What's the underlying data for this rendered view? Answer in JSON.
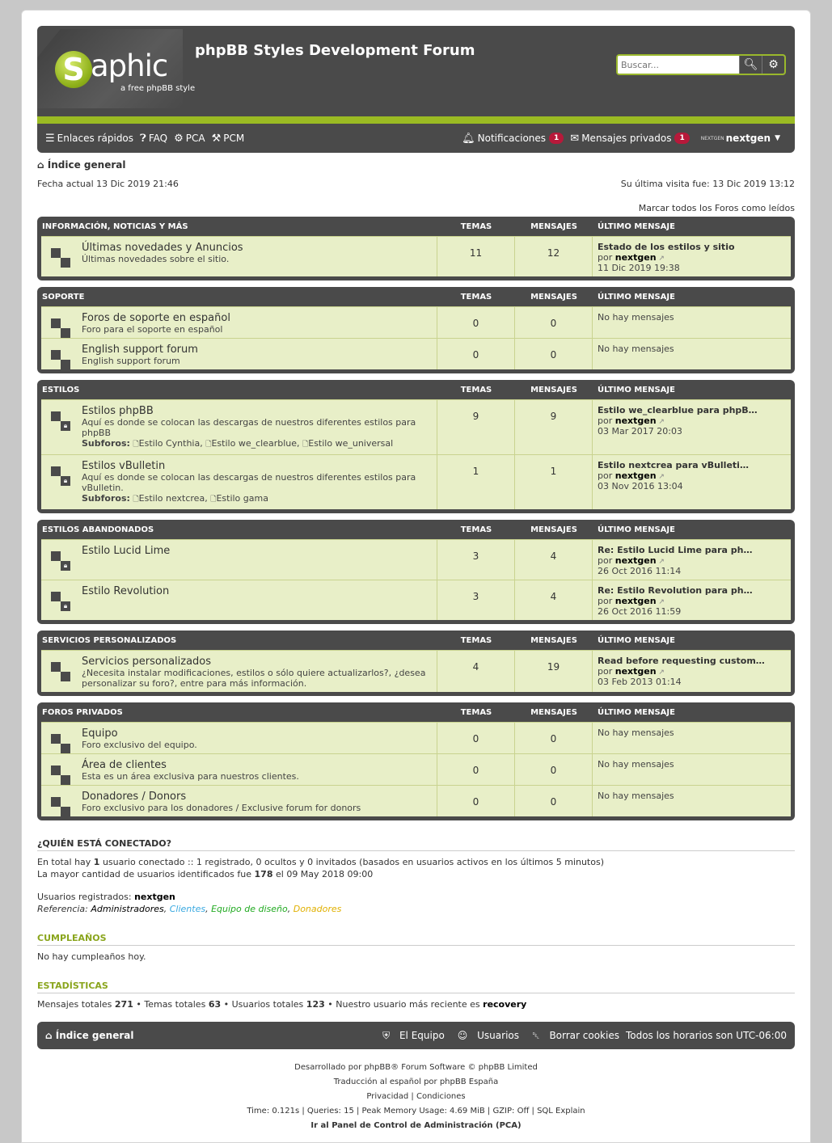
{
  "header": {
    "logo_letter": "S",
    "logo_rest": "aphic",
    "logo_sub": "a free phpBB style",
    "site_title": "phpBB Styles Development Forum",
    "search_placeholder": "Buscar..."
  },
  "nav": {
    "quick_links": "Enlaces rápidos",
    "faq": "FAQ",
    "acp": "PCA",
    "mcp": "PCM",
    "notifications": "Notificaciones",
    "notifications_count": "1",
    "private_messages": "Mensajes privados",
    "pm_count": "1",
    "avatar_text": "NEXTGEN",
    "username": "nextgen"
  },
  "breadcrumb": "Índice general",
  "current_time": "Fecha actual 13 Dic 2019 21:46",
  "last_visit": "Su última visita fue: 13 Dic 2019 13:12",
  "mark_read": "Marcar todos los Foros como leídos",
  "col_topics": "TEMAS",
  "col_posts": "MENSAJES",
  "col_last": "ÚLTIMO MENSAJE",
  "subforums_label": "Subforos:",
  "by_label": "por",
  "categories": [
    {
      "name": "INFORMACIÓN, NOTICIAS Y MÁS",
      "forums": [
        {
          "title": "Últimas novedades y Anuncios",
          "desc": "Últimas novedades sobre el sitio.",
          "topics": "11",
          "posts": "12",
          "last_title": "Estado de los estilos y sitio",
          "last_user": "nextgen",
          "last_date": "11 Dic 2019 19:38",
          "locked": false
        }
      ]
    },
    {
      "name": "SOPORTE",
      "forums": [
        {
          "title": "Foros de soporte en español",
          "desc": "Foro para el soporte en español",
          "topics": "0",
          "posts": "0",
          "no_posts": "No hay mensajes",
          "locked": false
        },
        {
          "title": "English support forum",
          "desc": "English support forum",
          "topics": "0",
          "posts": "0",
          "no_posts": "No hay mensajes",
          "locked": false
        }
      ]
    },
    {
      "name": "ESTILOS",
      "forums": [
        {
          "title": "Estilos phpBB",
          "desc": "Aquí es donde se colocan las descargas de nuestros diferentes estilos para phpBB",
          "subforums": [
            "Estilo Cynthia,",
            "Estilo we_clearblue,",
            "Estilo we_universal"
          ],
          "topics": "9",
          "posts": "9",
          "last_title": "Estilo we_clearblue para phpB…",
          "last_user": "nextgen",
          "last_date": "03 Mar 2017 20:03",
          "locked": true
        },
        {
          "title": "Estilos vBulletin",
          "desc": "Aquí es donde se colocan las descargas de nuestros diferentes estilos para vBulletin.",
          "subforums": [
            "Estilo nextcrea,",
            "Estilo gama"
          ],
          "topics": "1",
          "posts": "1",
          "last_title": "Estilo nextcrea para vBulleti…",
          "last_user": "nextgen",
          "last_date": "03 Nov 2016 13:04",
          "locked": true
        }
      ]
    },
    {
      "name": "ESTILOS ABANDONADOS",
      "forums": [
        {
          "title": "Estilo Lucid Lime",
          "desc": "",
          "topics": "3",
          "posts": "4",
          "last_title": "Re: Estilo Lucid Lime para ph…",
          "last_user": "nextgen",
          "last_date": "26 Oct 2016 11:14",
          "locked": true
        },
        {
          "title": "Estilo Revolution",
          "desc": "",
          "topics": "3",
          "posts": "4",
          "last_title": "Re: Estilo Revolution para ph…",
          "last_user": "nextgen",
          "last_date": "26 Oct 2016 11:59",
          "locked": true
        }
      ]
    },
    {
      "name": "SERVICIOS PERSONALIZADOS",
      "forums": [
        {
          "title": "Servicios personalizados",
          "desc": "¿Necesita instalar modificaciones, estilos o sólo quiere actualizarlos?, ¿desea personalizar su foro?, entre para más información.",
          "topics": "4",
          "posts": "19",
          "last_title": "Read before requesting custom…",
          "last_user": "nextgen",
          "last_date": "03 Feb 2013 01:14",
          "locked": false
        }
      ]
    },
    {
      "name": "FOROS PRIVADOS",
      "forums": [
        {
          "title": "Equipo",
          "desc": "Foro exclusivo del equipo.",
          "topics": "0",
          "posts": "0",
          "no_posts": "No hay mensajes",
          "locked": false
        },
        {
          "title": "Área de clientes",
          "desc": "Esta es un área exclusiva para nuestros clientes.",
          "topics": "0",
          "posts": "0",
          "no_posts": "No hay mensajes",
          "locked": false
        },
        {
          "title": "Donadores / Donors",
          "desc": "Foro exclusivo para los donadores / Exclusive forum for donors",
          "topics": "0",
          "posts": "0",
          "no_posts": "No hay mensajes",
          "locked": false
        }
      ]
    }
  ],
  "online": {
    "heading": "¿QUIÉN ESTÁ CONECTADO?",
    "line1_a": "En total hay ",
    "line1_count": "1",
    "line1_b": " usuario conectado :: 1 registrado, 0 ocultos y 0 invitados (basados en usuarios activos en los últimos 5 minutos)",
    "line2_a": "La mayor cantidad de usuarios identificados fue ",
    "line2_count": "178",
    "line2_b": " el 09 May 2018 09:00",
    "registered_label": "Usuarios registrados: ",
    "registered_user": "nextgen",
    "legend_label": "Referencia: ",
    "legend": [
      {
        "name": "Administradores",
        "color": "#000000"
      },
      {
        "name": "Clientes",
        "color": "#3aa9e0"
      },
      {
        "name": "Equipo de diseño",
        "color": "#22aa22"
      },
      {
        "name": "Donadores",
        "color": "#e0b000"
      }
    ]
  },
  "birthdays": {
    "heading": "CUMPLEAÑOS",
    "text": "No hay cumpleaños hoy."
  },
  "stats": {
    "heading": "ESTADÍSTICAS",
    "posts_label": "Mensajes totales ",
    "posts": "271",
    "topics_label": " • Temas totales ",
    "topics": "63",
    "users_label": " • Usuarios totales ",
    "users": "123",
    "newest_label": " • Nuestro usuario más reciente es ",
    "newest": "recovery"
  },
  "footer_nav": {
    "index": "Índice general",
    "team": "El Equipo",
    "users": "Usuarios",
    "cookies": "Borrar cookies",
    "timezone": "Todos los horarios son UTC-06:00"
  },
  "copyright": {
    "line1": "Desarrollado por phpBB® Forum Software © phpBB Limited",
    "line2": "Traducción al español por phpBB España",
    "line3": "Privacidad | Condiciones",
    "line4": "Time: 0.121s | Queries: 15 | Peak Memory Usage: 4.69 MiB | GZIP: Off | SQL Explain",
    "line5": "Ir al Panel de Control de Administración (PCA)"
  },
  "colors": {
    "accent": "#9bbb23",
    "dark": "#4a4a4a",
    "row_bg": "#e8efc8",
    "badge": "#b7193a"
  }
}
